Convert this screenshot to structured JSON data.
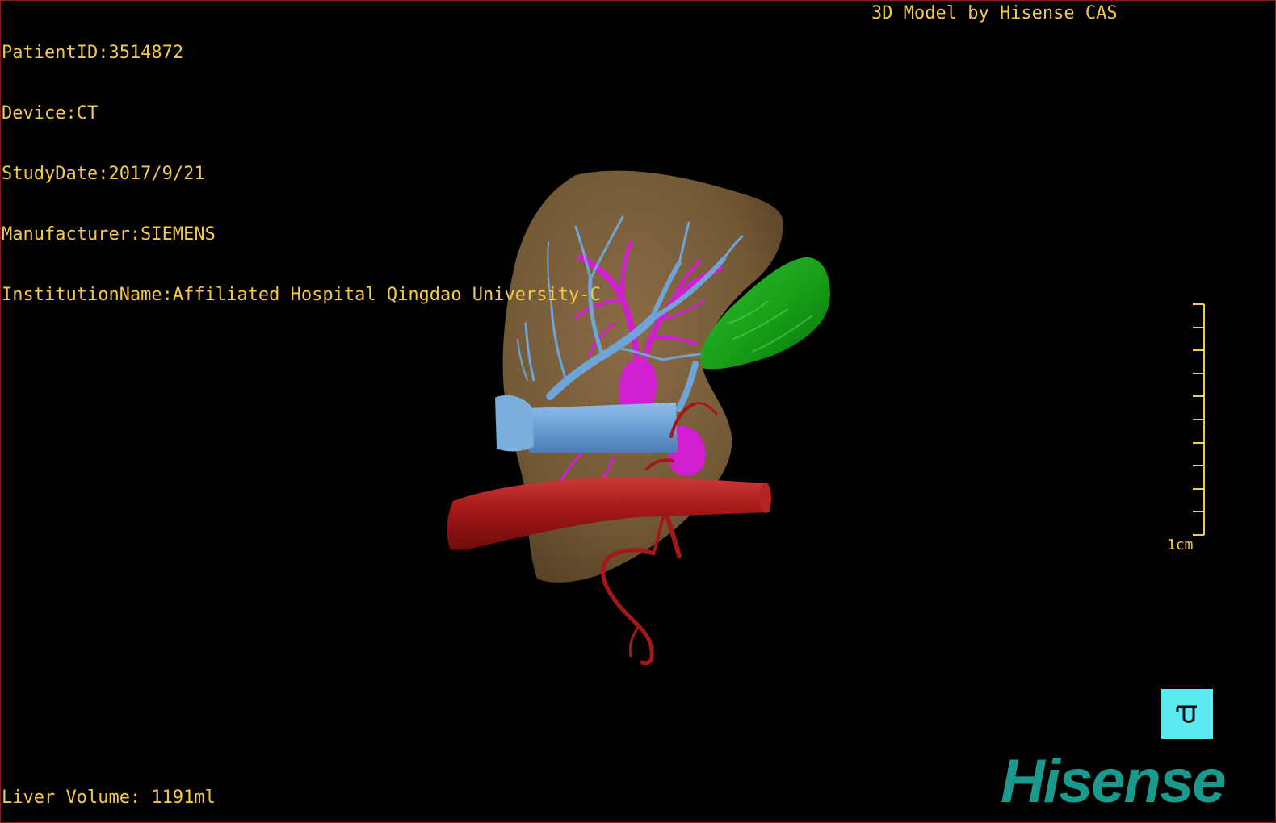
{
  "header": {
    "patient_id": "PatientID:3514872",
    "device": "Device:CT",
    "study_date": "StudyDate:2017/9/21",
    "manufacturer": "Manufacturer:SIEMENS",
    "institution": "InstitutionName:Affiliated Hospital Qingdao University-C"
  },
  "model_credit": "3D Model by Hisense CAS",
  "footer": {
    "liver_volume": "Liver Volume: 1191ml"
  },
  "scale_bar": {
    "label": "1cm"
  },
  "brand": {
    "logo_text": "Hisense",
    "logo_color": "#1a9a8c"
  },
  "colors": {
    "overlay_text": "#f2c94c",
    "liver": "#7a5f3c",
    "portal_vein": "#6fa4d8",
    "hepatic_vein": "#d11fcf",
    "artery": "#b51e1e",
    "gallbladder": "#1fa51f",
    "orientation_button": "#5ce8f0"
  },
  "icons": {
    "orientation": "orientation-cube-icon"
  }
}
